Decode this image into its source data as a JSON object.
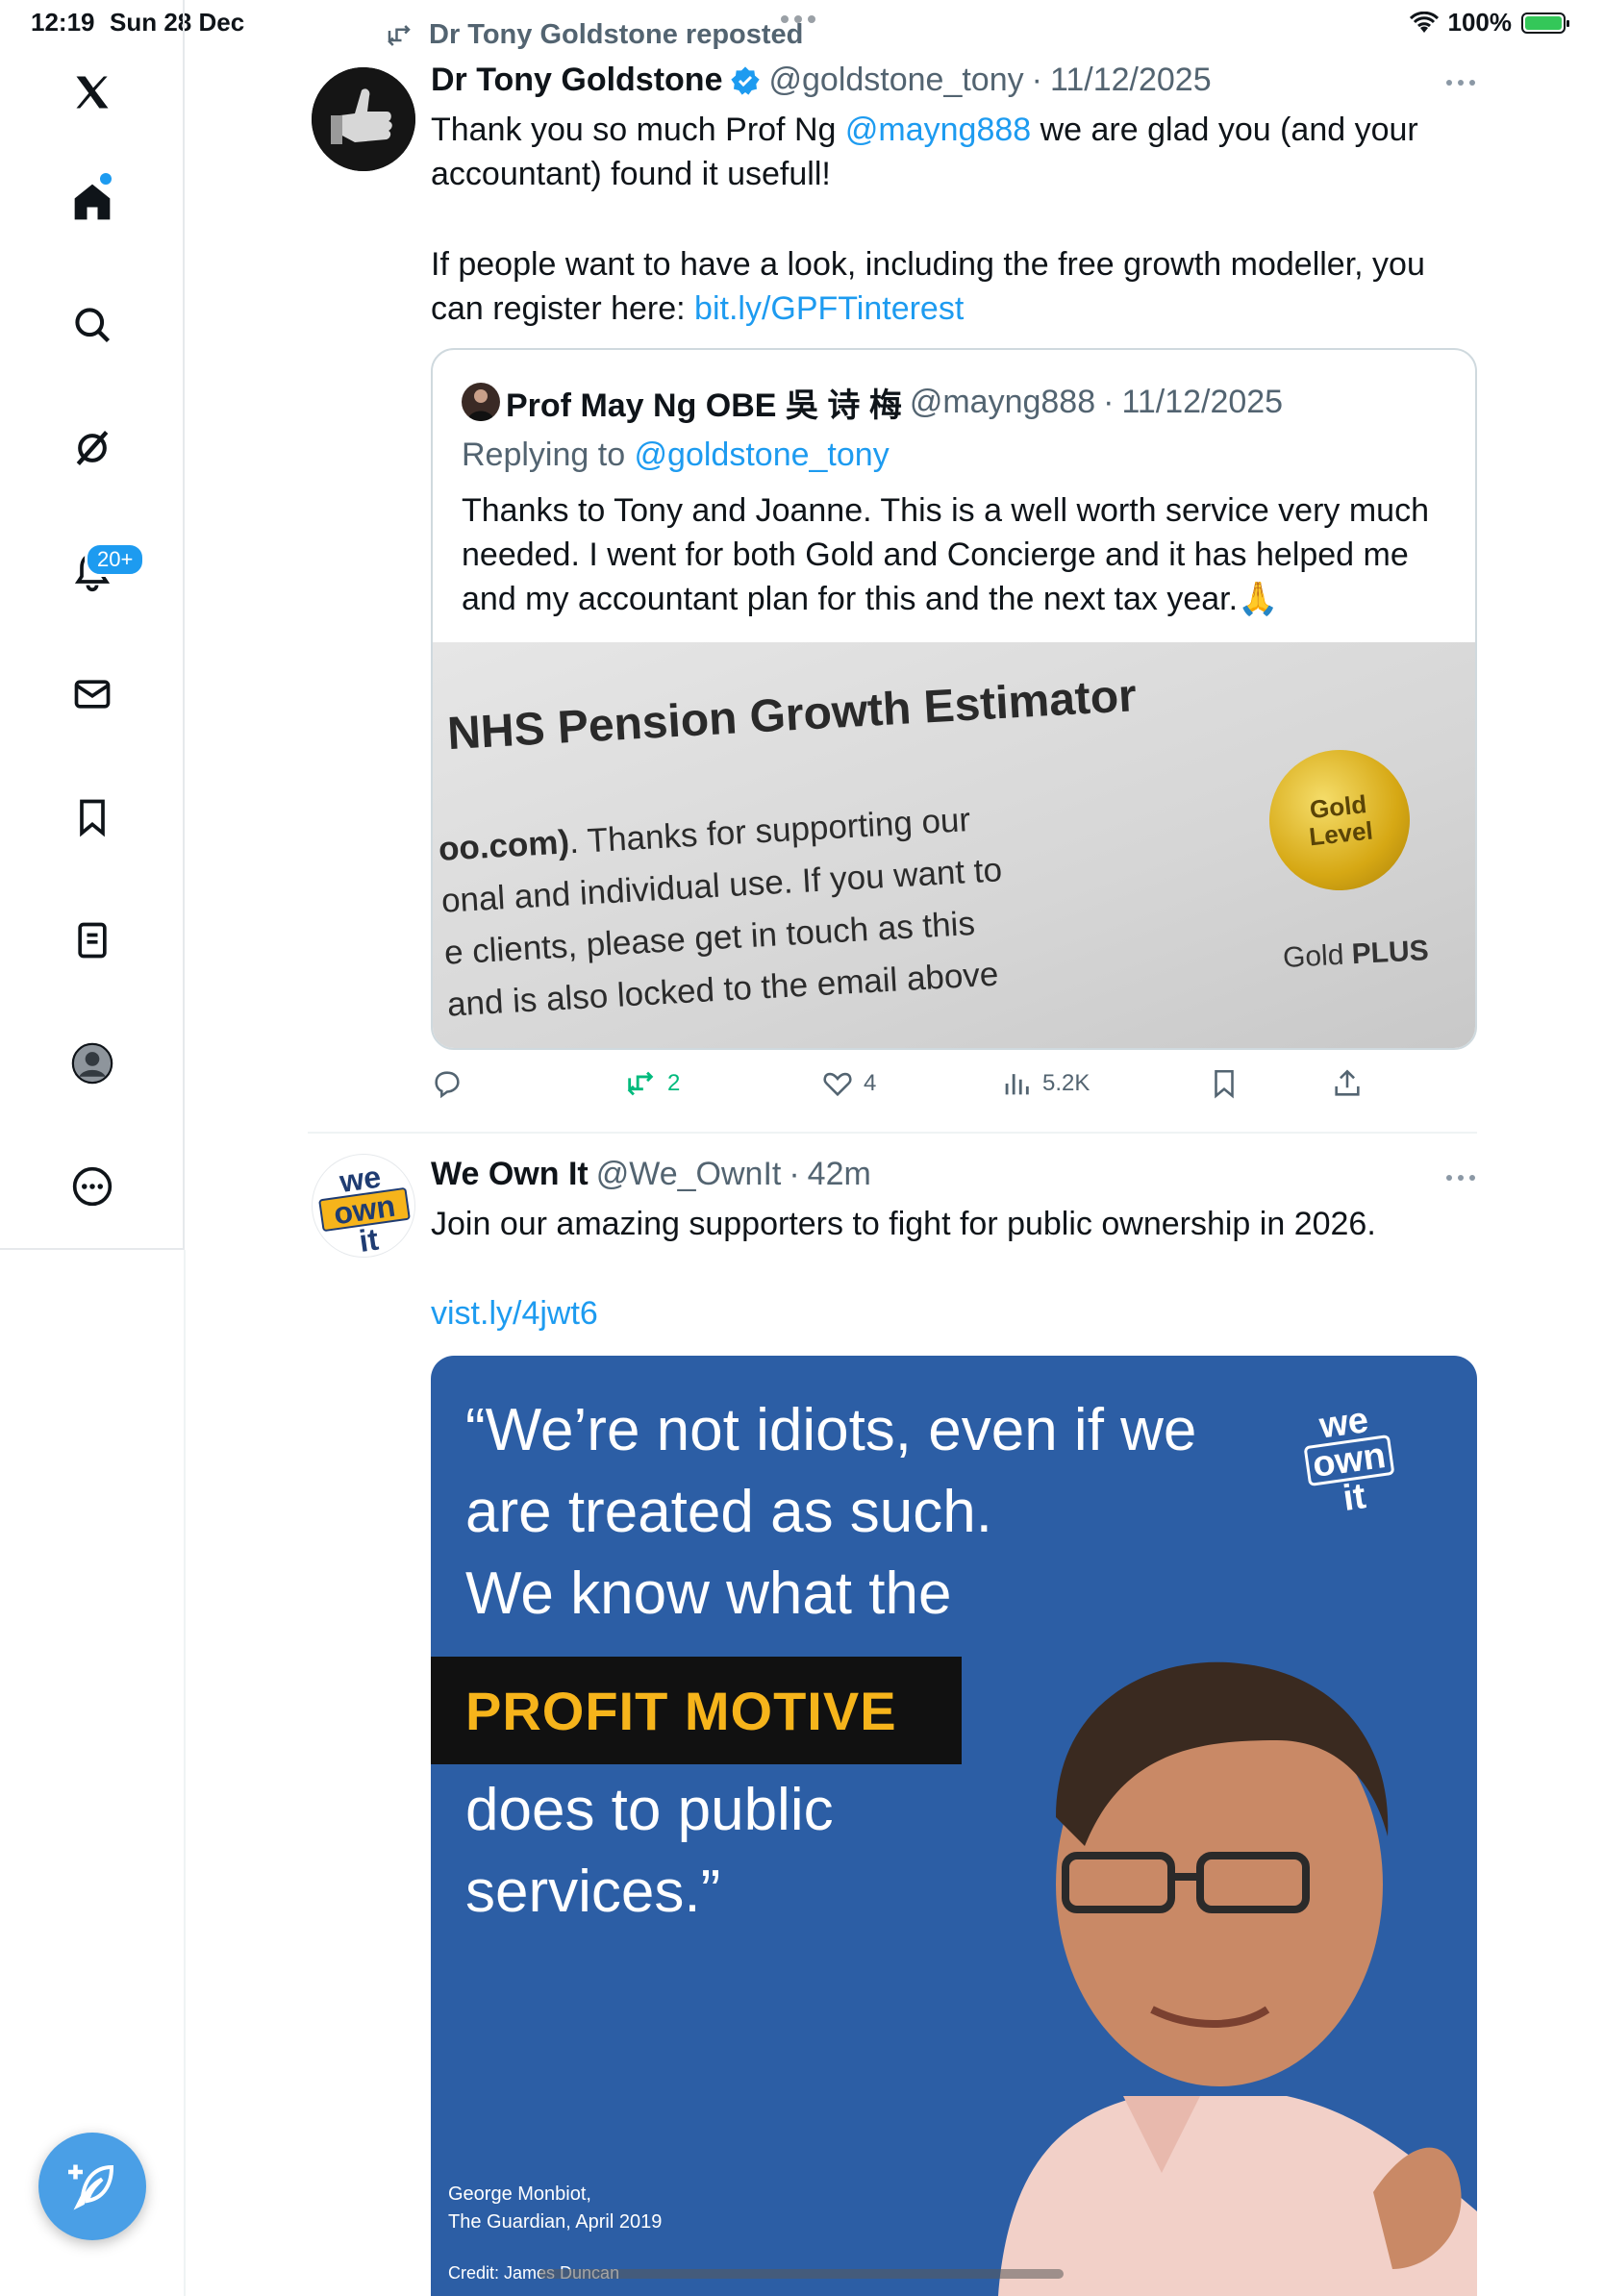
{
  "status_bar": {
    "time": "12:19",
    "date": "Sun 28 Dec",
    "battery": "100%",
    "battery_level": 1.0
  },
  "sidebar": {
    "notifications_badge": "20+",
    "items": [
      "x-logo-icon",
      "home-icon",
      "search-icon",
      "grok-icon",
      "notifications-icon",
      "messages-icon",
      "bookmarks-icon",
      "lists-icon",
      "profile-icon",
      "more-icon"
    ]
  },
  "repost_banner": {
    "text": "Dr Tony Goldstone reposted"
  },
  "tweet1": {
    "name": "Dr Tony Goldstone",
    "handle": "@goldstone_tony",
    "sep": "·",
    "date": "11/12/2025",
    "text_a": "Thank you so much Prof Ng ",
    "mention": "@mayng888",
    "text_b": " we are glad you (and your accountant) found it usefull!",
    "text_c": "If people want to have a look, including the free growth modeller, you can register here: ",
    "link": "bit.ly/GPFTinterest",
    "quote": {
      "name": "Prof May Ng OBE 吳 诗 梅",
      "handle": "@mayng888",
      "sep": "·",
      "date": "11/12/2025",
      "replying_label": "Replying to ",
      "replying_handle": "@goldstone_tony",
      "text": "Thanks to Tony and Joanne. This is a well worth service very much needed. I went for both Gold and Concierge and it has helped me and my accountant plan for this and the next tax year.🙏",
      "image": {
        "title": "NHS Pension Growth Estimator",
        "line1_bold": "oo.com)",
        "line1": ". Thanks for supporting our",
        "line2": "onal and individual use. If you want to",
        "line3": "e clients, please get in touch as this",
        "line4": "and is also locked to the email above",
        "seal_line1": "Gold",
        "seal_line2": "Level",
        "gold": "Gold ",
        "plus": "PLUS"
      }
    },
    "stats": {
      "reposts": "2",
      "likes": "4",
      "views": "5.2K"
    }
  },
  "tweet2": {
    "name": "We Own It",
    "handle": "@We_OwnIt",
    "sep": "·",
    "time": "42m",
    "text": "Join our amazing supporters to fight for public ownership in 2026.",
    "link": "vist.ly/4jwt6",
    "logo": {
      "l1": "we",
      "l2": "own",
      "l3": "it"
    },
    "image": {
      "quote_l1": "“We’re not idiots, even if we",
      "quote_l2": "are treated as such.",
      "quote_l3": "We know what the",
      "highlight": "PROFIT MOTIVE",
      "quote_l4": "does to public",
      "quote_l5": "services.”",
      "attribution_l1": "George Monbiot,",
      "attribution_l2": "The Guardian, April 2019",
      "credit": "Credit: James Duncan"
    }
  },
  "colors": {
    "accent": "#1d9bf0",
    "repost_green": "#00ba7c",
    "promo_blue": "#2c5ea5",
    "profit_yellow": "#f6b41b"
  }
}
